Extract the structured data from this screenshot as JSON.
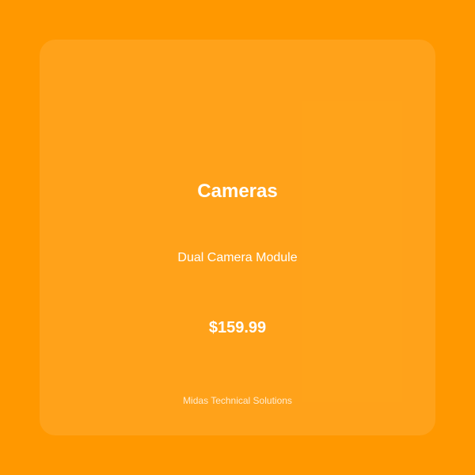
{
  "colors": {
    "background": "#FF9800",
    "card": "rgba(255,255,255,0.1)",
    "text": "#FFFFFF"
  },
  "card": {
    "category": "Cameras",
    "product_name": "Dual Camera Module",
    "price": "$159.99",
    "company": "Midas Technical Solutions"
  }
}
